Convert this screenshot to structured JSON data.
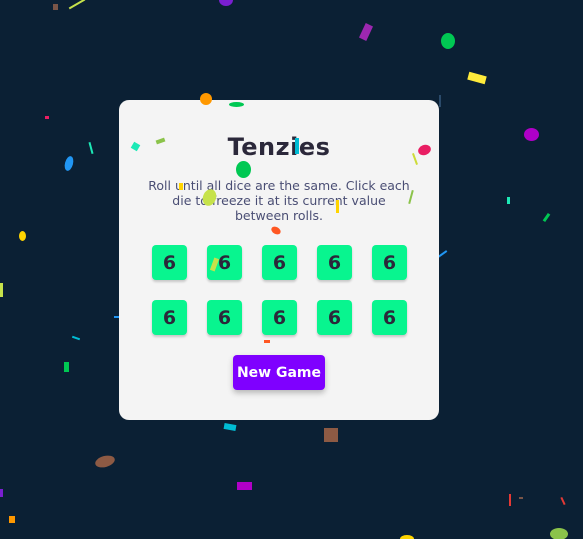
{
  "game": {
    "title": "Tenzies",
    "instructions": "Roll until all dice are the same. Click each die to freeze it at its current value between rolls.",
    "dice": [
      "6",
      "6",
      "6",
      "6",
      "6",
      "6",
      "6",
      "6",
      "6",
      "6"
    ],
    "button_label": "New Game"
  },
  "colors": {
    "background": "#0b2034",
    "card": "#f4f4f4",
    "die_held": "#08f58f",
    "button": "#7f00ff",
    "confetti": [
      "#7f00ff",
      "#ffd400",
      "#00c853",
      "#2196f3",
      "#ff9800",
      "#e91e63",
      "#8bc34a",
      "#00bcd4",
      "#795548",
      "#ff5722",
      "#cddc39",
      "#1de9b6"
    ]
  }
}
